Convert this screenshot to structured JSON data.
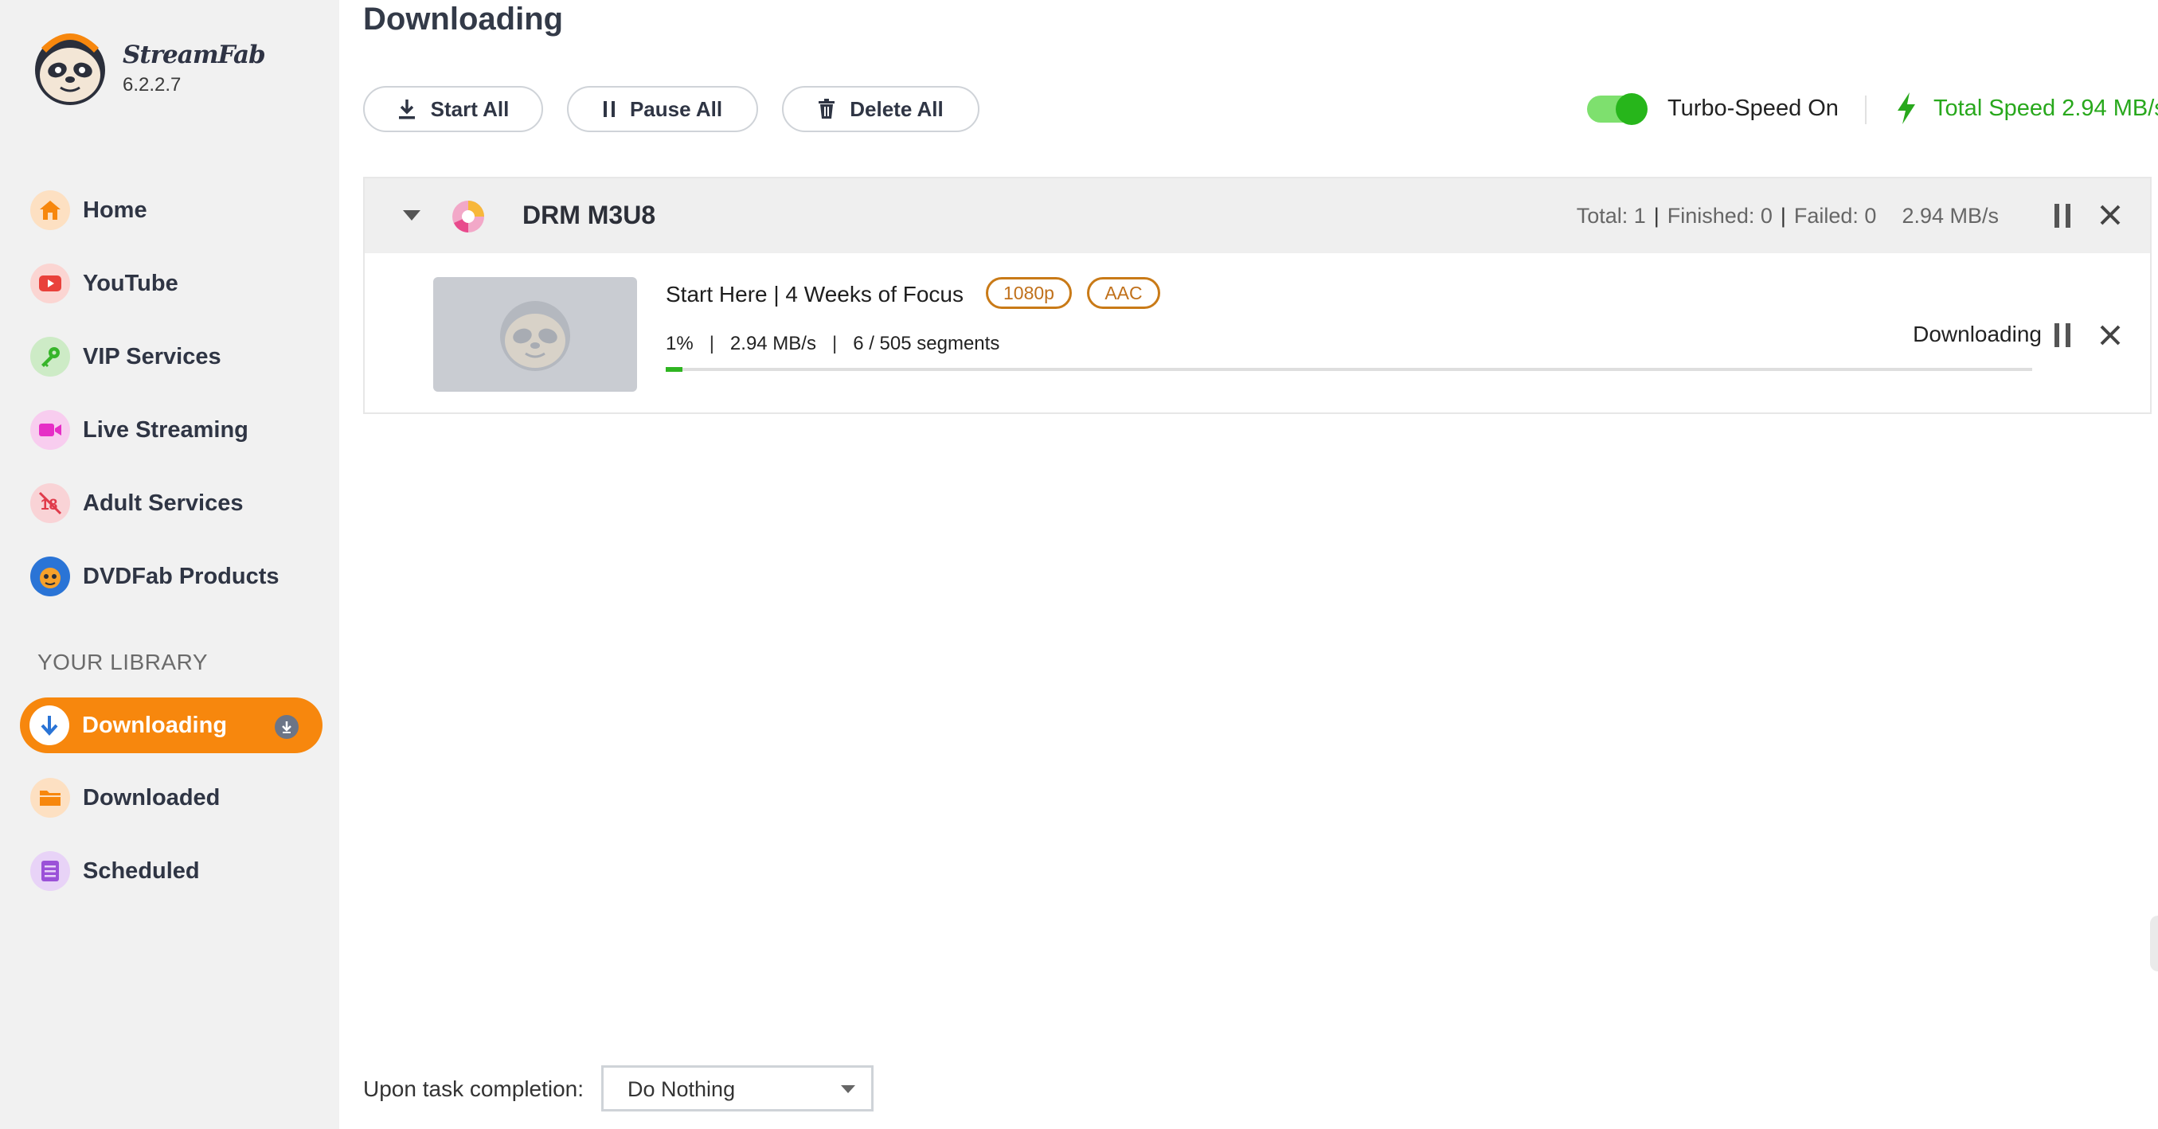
{
  "app": {
    "name": "StreamFab",
    "version": "6.2.2.7"
  },
  "sidebar": {
    "items": [
      {
        "label": "Home",
        "icon": "home-icon",
        "color": "#f7870d"
      },
      {
        "label": "YouTube",
        "icon": "youtube-icon",
        "color": "#e9413b"
      },
      {
        "label": "VIP Services",
        "icon": "key-icon",
        "color": "#37b52a"
      },
      {
        "label": "Live Streaming",
        "icon": "camera-icon",
        "color": "#e62ec6"
      },
      {
        "label": "Adult Services",
        "icon": "adult-18-icon",
        "color": "#e03a4a"
      },
      {
        "label": "DVDFab Products",
        "icon": "dvdfab-icon",
        "color": "#2a74d6"
      }
    ],
    "library_title": "YOUR LIBRARY",
    "library": [
      {
        "label": "Downloading",
        "icon": "download-icon",
        "active": true
      },
      {
        "label": "Downloaded",
        "icon": "folder-icon",
        "color": "#f7870d"
      },
      {
        "label": "Scheduled",
        "icon": "list-icon",
        "color": "#9b51d8"
      }
    ]
  },
  "header": {
    "title": "Downloading",
    "start_all": "Start All",
    "pause_all": "Pause All",
    "delete_all": "Delete All",
    "turbo_label": "Turbo-Speed On",
    "turbo_on": true,
    "total_speed": "Total Speed 2.94 MB/s"
  },
  "group": {
    "title": "DRM M3U8",
    "total": "Total: 1",
    "finished": "Finished: 0",
    "failed": "Failed: 0",
    "speed": "2.94 MB/s"
  },
  "item": {
    "title": "Start Here | 4 Weeks of Focus",
    "tags": [
      "1080p",
      "AAC"
    ],
    "percent": "1%",
    "speed": "2.94 MB/s",
    "segments": "6 / 505 segments",
    "progress": 0.012,
    "status": "Downloading"
  },
  "footer": {
    "completion_label": "Upon task completion:",
    "completion_value": "Do Nothing"
  },
  "colors": {
    "accent": "#f7870d",
    "success": "#28a81c",
    "tag": "#c97a17"
  }
}
